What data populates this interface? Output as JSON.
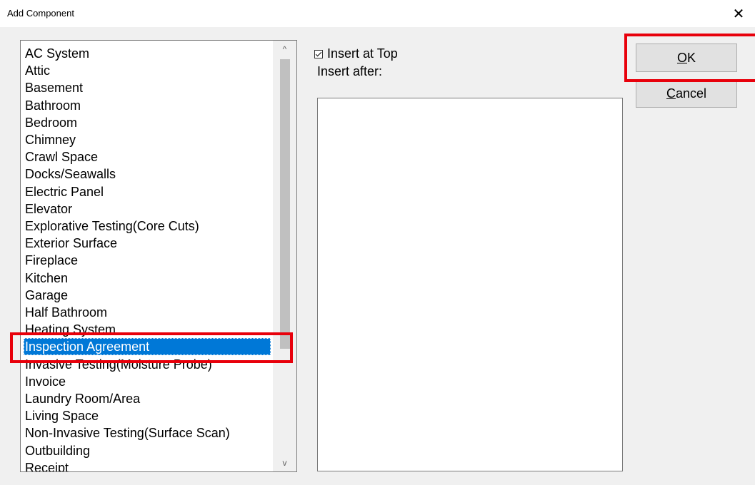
{
  "window": {
    "title": "Add Component",
    "close_glyph": "✕"
  },
  "component_list": {
    "items": [
      "AC System",
      "Attic",
      "Basement",
      "Bathroom",
      "Bedroom",
      "Chimney",
      "Crawl Space",
      "Docks/Seawalls",
      "Electric Panel",
      "Elevator",
      "Explorative Testing(Core Cuts)",
      "Exterior Surface",
      "Fireplace",
      "Kitchen",
      "Garage",
      "Half Bathroom",
      "Heating System",
      "Inspection Agreement",
      "Invasive Testing(Moisture Probe)",
      "Invoice",
      "Laundry Room/Area",
      "Living Space",
      "Non-Invasive Testing(Surface Scan)",
      "Outbuilding",
      "Receipt"
    ],
    "selected": "Inspection Agreement",
    "scroll_up_glyph": "^",
    "scroll_down_glyph": "v"
  },
  "options": {
    "insert_at_top_label": "Insert at Top",
    "insert_at_top_checked": true,
    "insert_after_label": "Insert after:"
  },
  "buttons": {
    "ok_mnemonic": "O",
    "ok_rest": "K",
    "cancel_mnemonic": "C",
    "cancel_rest": "ancel"
  },
  "colors": {
    "selection": "#0078d7",
    "highlight": "#e8000b",
    "button_face": "#e1e1e1",
    "dialog_bg": "#f0f0f0"
  }
}
